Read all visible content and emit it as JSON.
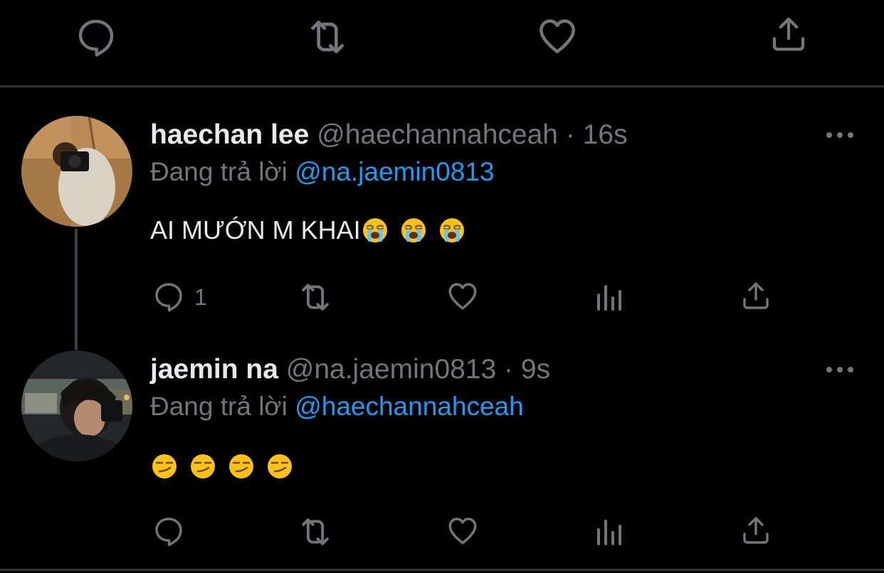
{
  "top_actions": [
    "reply-icon",
    "retweet-icon",
    "like-icon",
    "share-icon"
  ],
  "tweets": [
    {
      "name": "haechan lee",
      "handle": "@haechannahceah",
      "time": "16s",
      "reply_prefix": "Đang trả lời",
      "reply_to": "@na.jaemin0813",
      "text": "AI MƯỚN M KHAI",
      "emojis": [
        "loudly-crying-face",
        "loudly-crying-face",
        "loudly-crying-face"
      ],
      "reply_count": "1",
      "actions": [
        "reply-icon",
        "retweet-icon",
        "like-icon",
        "analytics-icon",
        "share-icon"
      ]
    },
    {
      "name": "jaemin na",
      "handle": "@na.jaemin0813",
      "time": "9s",
      "reply_prefix": "Đang trả lời",
      "reply_to": "@haechannahceah",
      "text": "",
      "emojis": [
        "smirking-face",
        "smirking-face",
        "smirking-face",
        "smirking-face"
      ],
      "reply_count": "",
      "actions": [
        "reply-icon",
        "retweet-icon",
        "like-icon",
        "analytics-icon",
        "share-icon"
      ]
    }
  ],
  "separator": "·"
}
